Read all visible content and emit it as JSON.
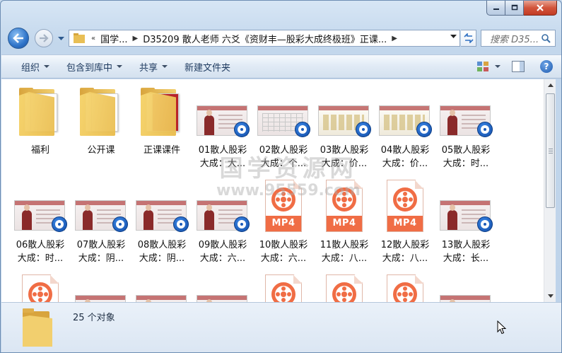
{
  "window": {
    "caption": {
      "minimize": "minimize",
      "maximize": "maximize",
      "close": "close"
    }
  },
  "nav": {
    "breadcrumb_prefix": "«",
    "breadcrumb": [
      "国学...",
      "D35209 散人老师 六爻《资财丰—股彩大成终极班》正课..."
    ],
    "search_placeholder": "搜索 D35..."
  },
  "commands": [
    {
      "label": "组织",
      "has_menu": true
    },
    {
      "label": "包含到库中",
      "has_menu": true
    },
    {
      "label": "共享",
      "has_menu": true
    },
    {
      "label": "新建文件夹",
      "has_menu": false
    }
  ],
  "items": [
    {
      "name": "福利",
      "type": "folder",
      "line2": ""
    },
    {
      "name": "公开课",
      "type": "folder",
      "line2": ""
    },
    {
      "name": "正课课件",
      "type": "folder",
      "line2": ""
    },
    {
      "name": "01散人股彩",
      "type": "video",
      "line2": "大成：大...",
      "thumb": "person"
    },
    {
      "name": "02散人股彩",
      "type": "video",
      "line2": "大成：个...",
      "thumb": "table"
    },
    {
      "name": "03散人股彩",
      "type": "video",
      "line2": "大成：价...",
      "thumb": "slide"
    },
    {
      "name": "04散人股彩",
      "type": "video",
      "line2": "大成：价...",
      "thumb": "slide"
    },
    {
      "name": "05散人股彩",
      "type": "video",
      "line2": "大成：时...",
      "thumb": "person"
    },
    {
      "name": "06散人股彩",
      "type": "video",
      "line2": "大成：时...",
      "thumb": "person"
    },
    {
      "name": "07散人股彩",
      "type": "video",
      "line2": "大成：阴...",
      "thumb": "person"
    },
    {
      "name": "08散人股彩",
      "type": "video",
      "line2": "大成：阴...",
      "thumb": "person"
    },
    {
      "name": "09散人股彩",
      "type": "video",
      "line2": "大成：六...",
      "thumb": "person"
    },
    {
      "name": "10散人股彩",
      "type": "mp4",
      "line2": "大成：六...",
      "badge": "MP4"
    },
    {
      "name": "11散人股彩",
      "type": "mp4",
      "line2": "大成：八...",
      "badge": "MP4"
    },
    {
      "name": "12散人股彩",
      "type": "mp4",
      "line2": "大成：八...",
      "badge": "MP4"
    },
    {
      "name": "13散人股彩",
      "type": "video",
      "line2": "大成：长...",
      "thumb": "person"
    },
    {
      "name": "",
      "type": "mp4-partial",
      "line2": ""
    },
    {
      "name": "",
      "type": "video-partial",
      "line2": ""
    },
    {
      "name": "",
      "type": "video-partial",
      "line2": ""
    },
    {
      "name": "",
      "type": "video-partial",
      "line2": ""
    },
    {
      "name": "",
      "type": "mp4-partial",
      "line2": ""
    },
    {
      "name": "",
      "type": "mp4-partial",
      "line2": ""
    },
    {
      "name": "",
      "type": "mp4-partial",
      "line2": ""
    },
    {
      "name": "",
      "type": "video-partial",
      "line2": ""
    }
  ],
  "watermark": {
    "big": "国学资源网",
    "small": "www.95559.com"
  },
  "details": {
    "count": "25 个对象"
  },
  "colors": {
    "accent_orange": "#f06d45",
    "qq_blue": "#1a5ab8",
    "folder": "#f2cf6e"
  }
}
